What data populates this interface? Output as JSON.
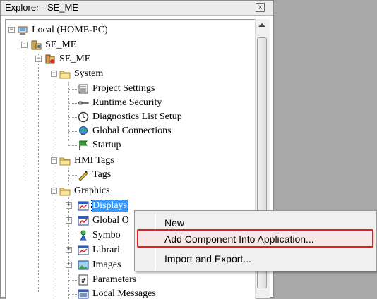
{
  "window": {
    "title": "Explorer - SE_ME",
    "close_glyph": "x"
  },
  "tree": {
    "root": "Local (HOME-PC)",
    "server": "SE_ME",
    "app": "SE_ME",
    "system": "System",
    "system_items": [
      "Project Settings",
      "Runtime Security",
      "Diagnostics List Setup",
      "Global Connections",
      "Startup"
    ],
    "hmi_tags": "HMI Tags",
    "tags": "Tags",
    "graphics": "Graphics",
    "graphics_items": [
      "Displays",
      "Global O",
      "Symbo",
      "Librari",
      "Images",
      "Parameters",
      "Local Messages"
    ]
  },
  "context_menu": {
    "items": [
      "New",
      "Add Component Into Application...",
      "Import and Export..."
    ]
  },
  "icons": {
    "computer": "computer-icon",
    "server": "server-icon",
    "application": "application-icon",
    "folder": "folder-icon",
    "settings": "settings-icon",
    "key": "key-icon",
    "clock": "clock-icon",
    "globe": "globe-icon",
    "flag": "flag-icon",
    "tag": "tag-icon",
    "display": "display-icon"
  }
}
